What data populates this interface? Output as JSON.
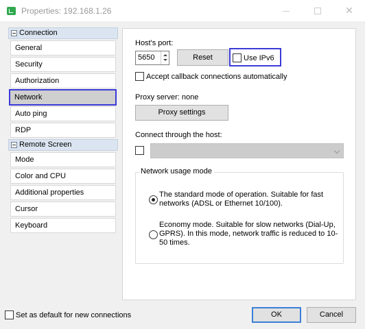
{
  "window": {
    "title": "Properties: 192.168.1.26",
    "close_glyph": "✕"
  },
  "sidebar": {
    "groups": [
      {
        "label": "Connection"
      },
      {
        "label": "Remote Screen"
      }
    ],
    "connection_items": [
      "General",
      "Security",
      "Authorization",
      "Network",
      "Auto ping",
      "RDP"
    ],
    "screen_items": [
      "Mode",
      "Color and CPU",
      "Additional properties",
      "Cursor",
      "Keyboard"
    ],
    "selected": "Network"
  },
  "network": {
    "port_label": "Host's port:",
    "port_value": "5650",
    "reset_label": "Reset",
    "ipv6_label": "Use IPv6",
    "ipv6_checked": false,
    "callback_label": "Accept callback connections automatically",
    "callback_checked": false,
    "proxy_label": "Proxy server: none",
    "proxy_button": "Proxy settings",
    "connect_through_label": "Connect through the host:",
    "connect_through_checked": false,
    "connect_through_value": "",
    "usage_mode_label": "Network usage mode",
    "mode_standard": "The standard mode of operation. Suitable for fast networks (ADSL or Ethernet 10/100).",
    "mode_economy": "Economy mode. Suitable for slow networks (Dial-Up, GPRS). In this mode, network traffic is reduced to 10-50 times.",
    "selected_mode": "standard"
  },
  "footer": {
    "default_label": "Set as default for new connections",
    "default_checked": false,
    "ok_label": "OK",
    "cancel_label": "Cancel"
  },
  "colors": {
    "accent": "#3a3ad8",
    "group_header": "#dbe5f1",
    "app_icon": "#2fa84f"
  }
}
